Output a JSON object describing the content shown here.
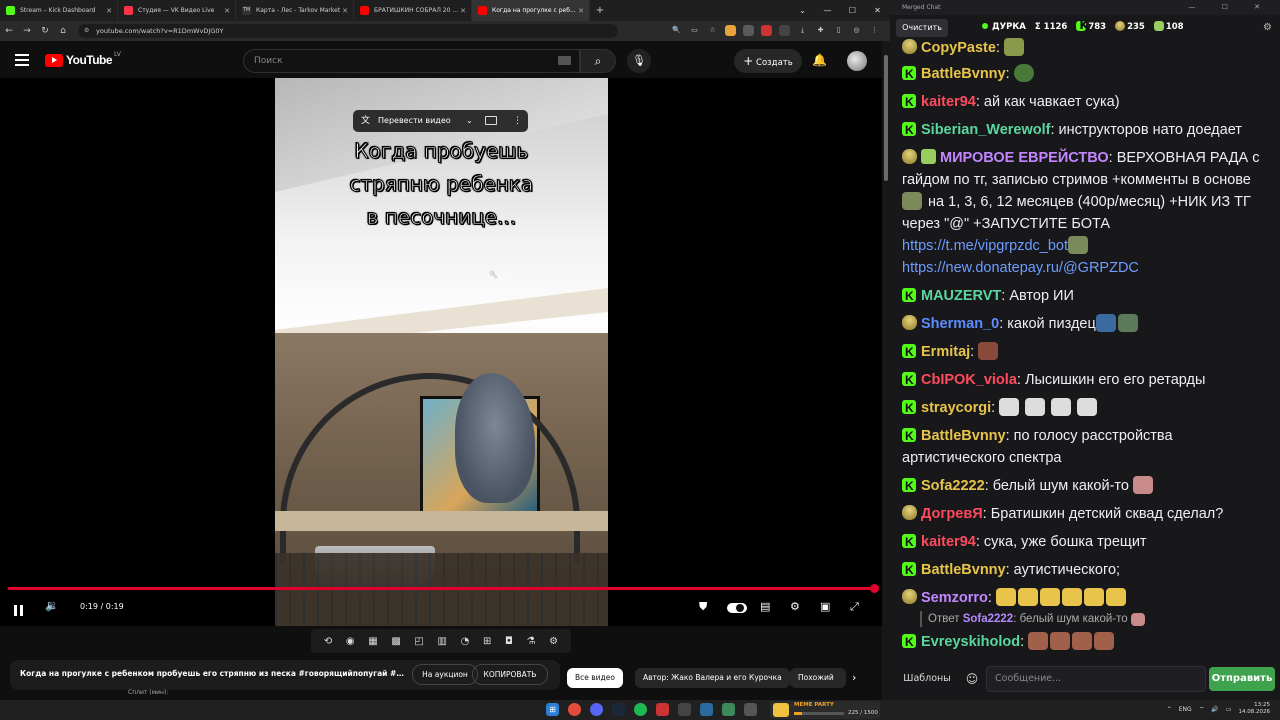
{
  "browser": {
    "tabs": [
      {
        "label": "Stream – Kick Dashboard",
        "color": "#53fc18"
      },
      {
        "label": "Студия — VK Видео Live",
        "color": "#ff3347"
      },
      {
        "label": "Карта - Лес - Tarkov Market",
        "color": "#333333"
      },
      {
        "label": "БРАТИШКИН СОБРАЛ 20 ВИТ...",
        "color": "#ff0000"
      },
      {
        "label": "Когда на прогулке с ребен...",
        "color": "#ff0000",
        "active": true
      }
    ],
    "url": "youtube.com/watch?v=R1DmWvDJG0Y"
  },
  "youtube": {
    "logo_text": "YouTube",
    "region": "LV",
    "search_placeholder": "Поиск",
    "create_label": "Создать",
    "translate_label": "Перевести видео",
    "caption": "Когда пробуешь\nстряпню ребенка\nв песочнице...",
    "time": "0:19 / 0:19",
    "progress": 1.0,
    "video_title": "Когда на прогулке с ребенком пробуешь его стряпню из песка #говорящийпопугай #попу...",
    "auction_label": "На аукцион",
    "copy_label": "КОПИРОВАТЬ",
    "split_label": "Сплит (мин):",
    "chips": [
      "Все видео",
      "Автор: Жако Валера и его Курочка",
      "Похожий"
    ]
  },
  "chat": {
    "window_title": "Merged Chat",
    "clear_label": "Очистить",
    "channel": "ДУРКА",
    "stats": {
      "total": "Σ 1126",
      "kick": "783",
      "vk": "235",
      "other": "108"
    },
    "messages": [
      {
        "user": "CopyPaste",
        "color": "#e8c54a",
        "badge": "sub",
        "text": ""
      },
      {
        "user": "BattleBvnny",
        "color": "#e8c54a",
        "badge": "kick",
        "text": ""
      },
      {
        "user": "kaiter94",
        "color": "#ff4a5e",
        "badge": "kick",
        "text": "ай как чавкает сука)"
      },
      {
        "user": "Siberian_Werewolf",
        "color": "#5ad6a0",
        "badge": "kick",
        "text": "инструкторов нато доедает"
      },
      {
        "user": "МИРОВОЕ ЕВРЕЙСТВО",
        "color": "#c287ff",
        "badge": "sub",
        "text": "ВЕРХОВНАЯ РАДА с гайдом по тг, записью стримов +комменты в основе",
        "text2": "на 1, 3, 6, 12 месяцев (400р/месяц) +НИК ИЗ ТГ через \"@\" +ЗАПУСТИТЕ БОТА",
        "link1": "https://t.me/vipgrpzdc_bot",
        "link2": "https://new.donatepay.ru/@GRPZDC"
      },
      {
        "user": "MAUZERVT",
        "color": "#5ad6a0",
        "badge": "kick",
        "text": "Автор ИИ"
      },
      {
        "user": "Sherman_0",
        "color": "#5b8cff",
        "badge": "sub",
        "text": "какой пиздец"
      },
      {
        "user": "Ermitaj",
        "color": "#e8c54a",
        "badge": "kick",
        "text": ""
      },
      {
        "user": "CbIPOK_viola",
        "color": "#ff4a5e",
        "badge": "kick",
        "text": "Лысишкин его его ретарды"
      },
      {
        "user": "straycorgi",
        "color": "#e8c54a",
        "badge": "kick",
        "text": ""
      },
      {
        "user": "BattleBvnny",
        "color": "#e8c54a",
        "badge": "kick",
        "text": "по голосу расстройства артистического спектра"
      },
      {
        "user": "Sofa2222",
        "color": "#e8c54a",
        "badge": "kick",
        "text": "белый шум какой-то"
      },
      {
        "user": "ДогревЯ",
        "color": "#ff4a5e",
        "badge": "sub",
        "text": "Братишкин детский сквад сделал?"
      },
      {
        "user": "kaiter94",
        "color": "#ff4a5e",
        "badge": "kick",
        "text": "сука, уже бошка трещит"
      },
      {
        "user": "BattleBvnny",
        "color": "#e8c54a",
        "badge": "kick",
        "text": "аутистического;"
      },
      {
        "user": "Semzorro",
        "color": "#c287ff",
        "badge": "sub",
        "text": ""
      },
      {
        "user": "Evreyskiholod",
        "color": "#5ad6a0",
        "badge": "kick",
        "text": ""
      }
    ],
    "reply": {
      "prefix": "Ответ",
      "user": "Sofa2222",
      "text": "белый шум какой-то"
    },
    "templates_label": "Шаблоны",
    "input_placeholder": "Сообщение...",
    "send_label": "Отправить"
  },
  "taskbar": {
    "meme_title": "MEME PARTY",
    "meme_count": "225 / 1500",
    "meme_progress": 0.15,
    "lang": "ENG",
    "time": "13:25",
    "date": "14.08.2026"
  }
}
